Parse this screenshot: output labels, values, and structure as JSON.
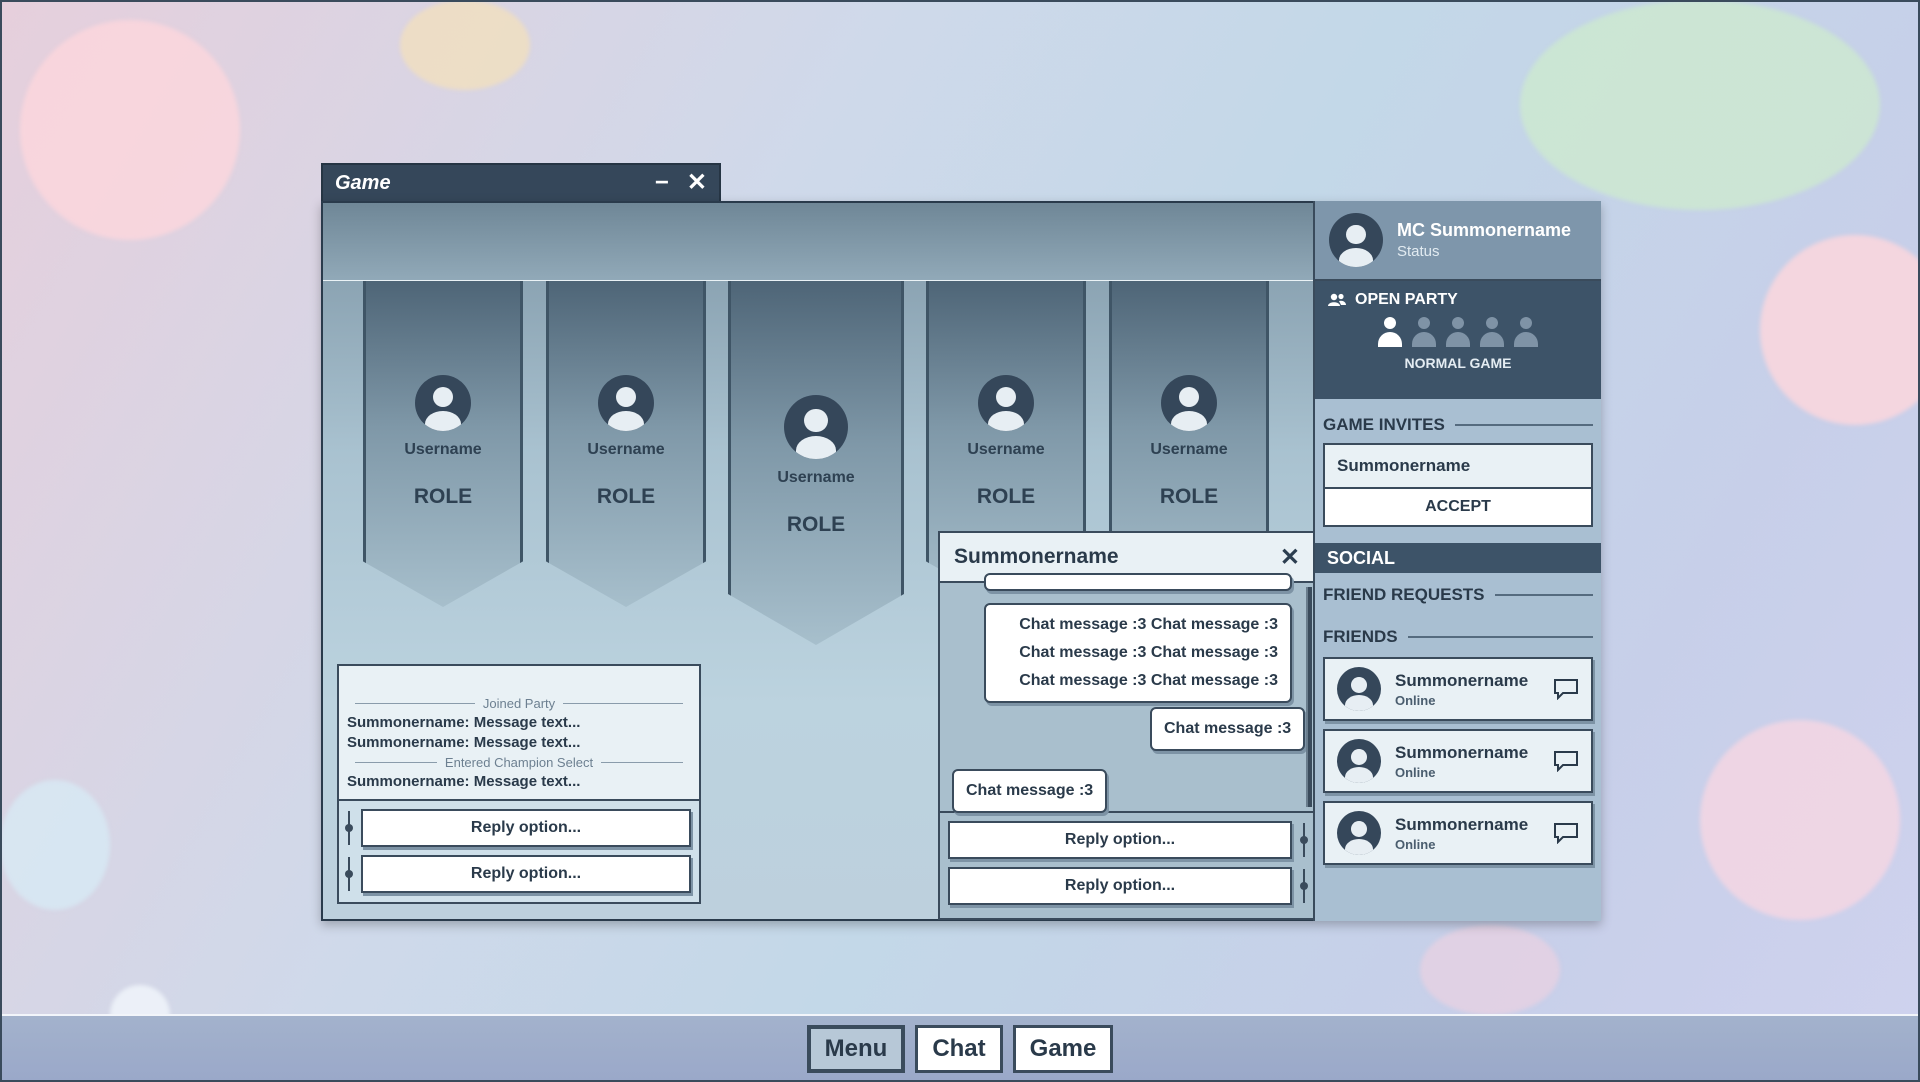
{
  "game_window": {
    "title": "Game",
    "minimize_glyph": "−",
    "close_glyph": "✕",
    "players": [
      {
        "username": "Username",
        "role": "ROLE"
      },
      {
        "username": "Username",
        "role": "ROLE"
      },
      {
        "username": "Username",
        "role": "ROLE"
      },
      {
        "username": "Username",
        "role": "ROLE"
      },
      {
        "username": "Username",
        "role": "ROLE"
      }
    ]
  },
  "party_log": {
    "events": [
      "Joined Party",
      "Entered Champion Select"
    ],
    "messages": [
      "Summonername: Message text...",
      "Summonername: Message text...",
      "Summonername: Message text..."
    ],
    "replies": [
      "Reply option...",
      "Reply option..."
    ]
  },
  "chat": {
    "header": "Summonername",
    "close_glyph": "✕",
    "messages": [
      {
        "text": "Chat message :3 Chat message :3 Chat message :3 Chat message :3 Chat message :3 Chat message :3",
        "side": "right"
      },
      {
        "text": "Chat message :3",
        "side": "right"
      },
      {
        "text": "Chat message :3",
        "side": "left"
      }
    ],
    "replies": [
      "Reply option...",
      "Reply option..."
    ]
  },
  "sidebar": {
    "profile": {
      "name": "MC Summonername",
      "status": "Status"
    },
    "party": {
      "title": "OPEN PARTY",
      "filled_slots": 1,
      "total_slots": 5,
      "mode": "NORMAL GAME"
    },
    "game_invites": {
      "title": "GAME INVITES",
      "inviter": "Summonername",
      "accept_label": "ACCEPT"
    },
    "social": {
      "title": "SOCIAL",
      "friend_requests_label": "FRIEND REQUESTS",
      "friends_label": "FRIENDS",
      "friends": [
        {
          "name": "Summonername",
          "status": "Online"
        },
        {
          "name": "Summonername",
          "status": "Online"
        },
        {
          "name": "Summonername",
          "status": "Online"
        }
      ]
    }
  },
  "taskbar": {
    "buttons": [
      {
        "label": "Menu",
        "active": true
      },
      {
        "label": "Chat",
        "active": false
      },
      {
        "label": "Game",
        "active": false
      }
    ]
  },
  "colors": {
    "dark": "#35475a",
    "panel": "#a9bfd2",
    "light": "#e9f1f5"
  }
}
